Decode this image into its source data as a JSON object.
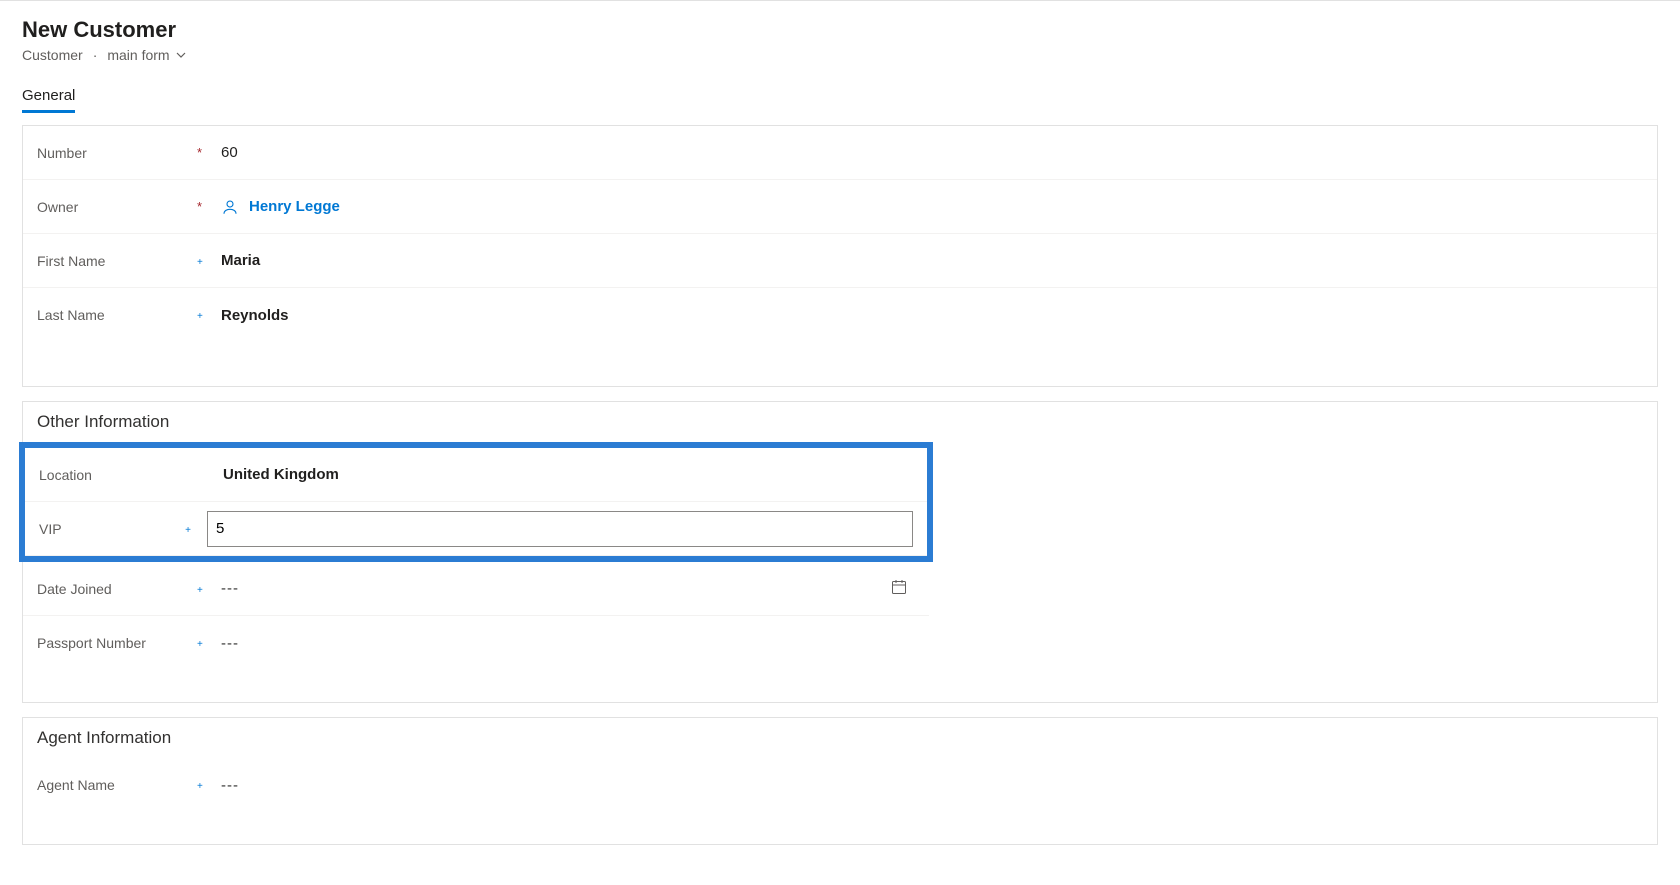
{
  "header": {
    "title": "New Customer",
    "entity_label": "Customer",
    "separator": "·",
    "form_name": "main form"
  },
  "tabs": {
    "general": "General"
  },
  "general_section": {
    "fields": {
      "number": {
        "label": "Number",
        "value": "60"
      },
      "owner": {
        "label": "Owner",
        "value": "Henry Legge"
      },
      "first_name": {
        "label": "First Name",
        "value": "Maria"
      },
      "last_name": {
        "label": "Last Name",
        "value": "Reynolds"
      }
    }
  },
  "other_info": {
    "title": "Other Information",
    "fields": {
      "location": {
        "label": "Location",
        "value": "United Kingdom"
      },
      "vip": {
        "label": "VIP",
        "value": "5"
      },
      "date_joined": {
        "label": "Date Joined",
        "value": "---"
      },
      "passport_number": {
        "label": "Passport Number",
        "value": "---"
      }
    }
  },
  "agent_info": {
    "title": "Agent Information",
    "fields": {
      "agent_name": {
        "label": "Agent Name",
        "value": "---"
      }
    }
  },
  "icons": {
    "required": "*",
    "recommended": "+"
  }
}
